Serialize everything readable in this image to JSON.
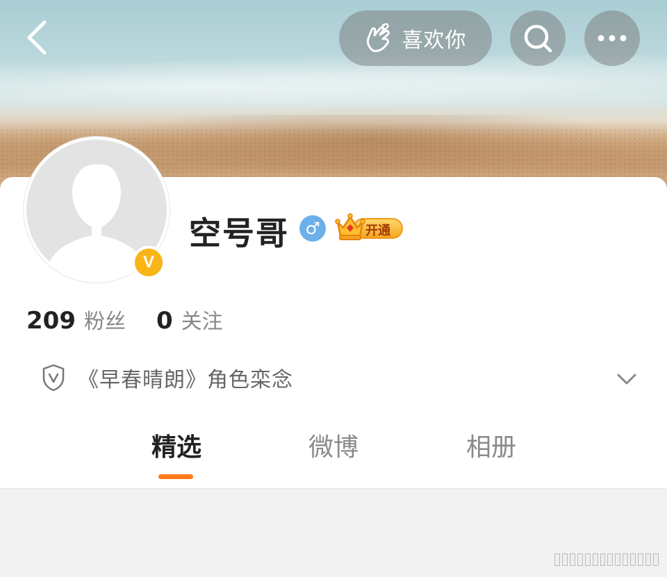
{
  "header": {
    "like_label": "喜欢你"
  },
  "profile": {
    "username": "空号哥",
    "gender_symbol": "♂",
    "vip_label": "开通",
    "verified_mark": "V"
  },
  "stats": {
    "followers_count": "209",
    "followers_label": "粉丝",
    "following_count": "0",
    "following_label": "关注"
  },
  "tag": {
    "text": "《早春晴朗》角色栾念"
  },
  "tabs": [
    {
      "label": "精选",
      "active": true
    },
    {
      "label": "微博",
      "active": false
    },
    {
      "label": "相册",
      "active": false
    }
  ],
  "colors": {
    "accent": "#ff7a1a",
    "verified": "#f9b417",
    "gender": "#6cb0ea"
  },
  "icons": [
    "back-arrow-icon",
    "heart-hand-icon",
    "search-icon",
    "more-icon",
    "shield-v-icon",
    "chevron-down-icon",
    "crown-icon"
  ]
}
